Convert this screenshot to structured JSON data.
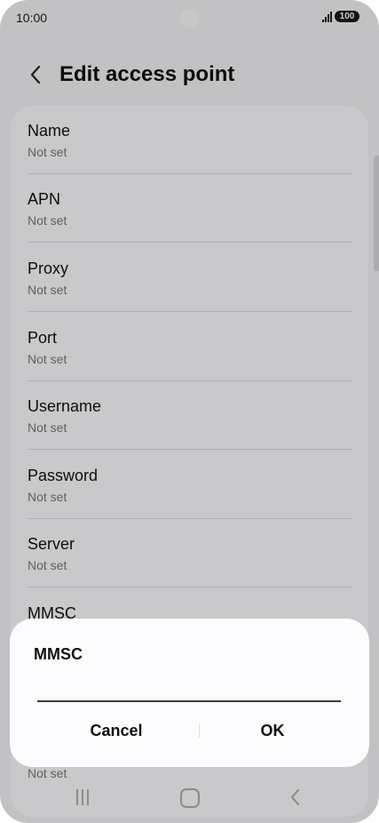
{
  "status_bar": {
    "time": "10:00",
    "battery": "100"
  },
  "header": {
    "title": "Edit access point"
  },
  "list": {
    "items": [
      {
        "label": "Name",
        "value": "Not set"
      },
      {
        "label": "APN",
        "value": "Not set"
      },
      {
        "label": "Proxy",
        "value": "Not set"
      },
      {
        "label": "Port",
        "value": "Not set"
      },
      {
        "label": "Username",
        "value": "Not set"
      },
      {
        "label": "Password",
        "value": "Not set"
      },
      {
        "label": "Server",
        "value": "Not set"
      },
      {
        "label": "MMSC",
        "value": ""
      },
      {
        "label": "",
        "value": "Not set"
      }
    ]
  },
  "dialog": {
    "title": "MMSC",
    "input_value": "",
    "cancel_label": "Cancel",
    "ok_label": "OK"
  },
  "icons": {
    "back": "chevron-left-icon",
    "signal": "signal-icon",
    "battery": "battery-icon",
    "nav_recent": "recent-apps-icon",
    "nav_home": "home-icon",
    "nav_back": "back-nav-icon"
  }
}
